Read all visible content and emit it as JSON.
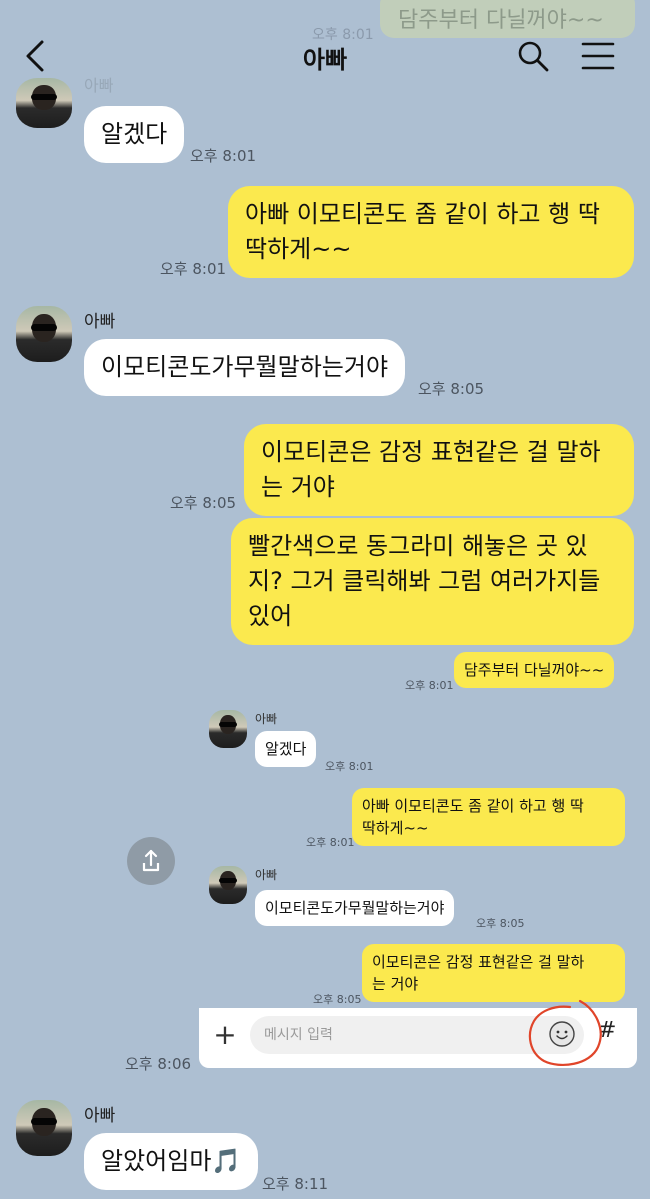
{
  "header": {
    "title": "아빠",
    "ghost_message": "담주부터 다닐꺼야~~",
    "ghost_time": "오후 8:01",
    "ghost_name": "아빠"
  },
  "messages": [
    {
      "text": "알겠다",
      "time": "오후 8:01"
    },
    {
      "lines": [
        "아빠 이모티콘도 좀 같이 하고 행 딱",
        "딱하게~~"
      ],
      "time": "오후 8:01"
    },
    {
      "sender": "아빠",
      "text": "이모티콘도가무뭘말하는거야",
      "time": "오후 8:05"
    },
    {
      "lines": [
        "이모티콘은 감정 표현같은 걸 말하",
        "는 거야"
      ],
      "time": "오후 8:05"
    },
    {
      "lines": [
        "빨간색으로 동그라미 해놓은 곳 있",
        "지? 그거 클릭해봐 그럼 여러가지들",
        "있어"
      ]
    },
    {
      "sender": "아빠",
      "text": "알았어임마🎵",
      "time": "오후 8:11"
    }
  ],
  "screenshot": {
    "yellow1": "담주부터 다닐꺼야~~",
    "time1": "오후 8:01",
    "name1": "아빠",
    "white1": "알겠다",
    "time2": "오후 8:01",
    "yellow2": [
      "아빠 이모티콘도 좀 같이 하고 행 딱",
      "딱하게~~"
    ],
    "time3": "오후 8:01",
    "name2": "아빠",
    "white2": "이모티콘도가무뭘말하는거야",
    "time4": "오후 8:05",
    "yellow3": [
      "이모티콘은 감정 표현같은 걸 말하",
      "는 거야"
    ],
    "time5": "오후 8:05",
    "input_placeholder": "메시지 입력",
    "hash": "#",
    "plus": "+"
  },
  "outer_time_under_shot": "오후 8:06",
  "icons": {
    "back": "chevron-left-icon",
    "search": "search-icon",
    "menu": "hamburger-menu-icon",
    "share": "share-icon",
    "emoji": "emoji-icon"
  },
  "colors": {
    "background": "#adbfd2",
    "yellow_bubble": "#fbe94e",
    "white_bubble": "#ffffff",
    "annotation_red": "#e0452a"
  }
}
